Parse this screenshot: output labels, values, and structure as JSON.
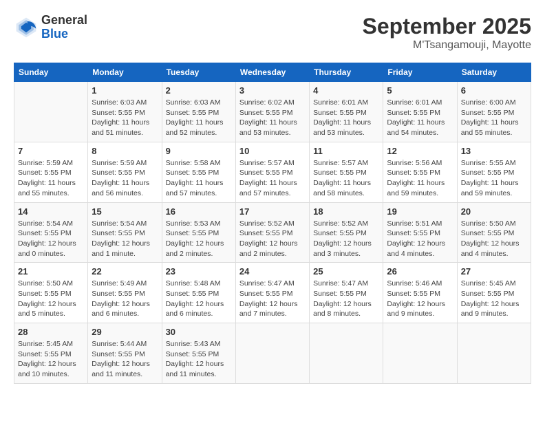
{
  "header": {
    "logo_general": "General",
    "logo_blue": "Blue",
    "month": "September 2025",
    "location": "M'Tsangamouji, Mayotte"
  },
  "days_of_week": [
    "Sunday",
    "Monday",
    "Tuesday",
    "Wednesday",
    "Thursday",
    "Friday",
    "Saturday"
  ],
  "weeks": [
    [
      {
        "day": "",
        "info": ""
      },
      {
        "day": "1",
        "info": "Sunrise: 6:03 AM\nSunset: 5:55 PM\nDaylight: 11 hours\nand 51 minutes."
      },
      {
        "day": "2",
        "info": "Sunrise: 6:03 AM\nSunset: 5:55 PM\nDaylight: 11 hours\nand 52 minutes."
      },
      {
        "day": "3",
        "info": "Sunrise: 6:02 AM\nSunset: 5:55 PM\nDaylight: 11 hours\nand 53 minutes."
      },
      {
        "day": "4",
        "info": "Sunrise: 6:01 AM\nSunset: 5:55 PM\nDaylight: 11 hours\nand 53 minutes."
      },
      {
        "day": "5",
        "info": "Sunrise: 6:01 AM\nSunset: 5:55 PM\nDaylight: 11 hours\nand 54 minutes."
      },
      {
        "day": "6",
        "info": "Sunrise: 6:00 AM\nSunset: 5:55 PM\nDaylight: 11 hours\nand 55 minutes."
      }
    ],
    [
      {
        "day": "7",
        "info": "Sunrise: 5:59 AM\nSunset: 5:55 PM\nDaylight: 11 hours\nand 55 minutes."
      },
      {
        "day": "8",
        "info": "Sunrise: 5:59 AM\nSunset: 5:55 PM\nDaylight: 11 hours\nand 56 minutes."
      },
      {
        "day": "9",
        "info": "Sunrise: 5:58 AM\nSunset: 5:55 PM\nDaylight: 11 hours\nand 57 minutes."
      },
      {
        "day": "10",
        "info": "Sunrise: 5:57 AM\nSunset: 5:55 PM\nDaylight: 11 hours\nand 57 minutes."
      },
      {
        "day": "11",
        "info": "Sunrise: 5:57 AM\nSunset: 5:55 PM\nDaylight: 11 hours\nand 58 minutes."
      },
      {
        "day": "12",
        "info": "Sunrise: 5:56 AM\nSunset: 5:55 PM\nDaylight: 11 hours\nand 59 minutes."
      },
      {
        "day": "13",
        "info": "Sunrise: 5:55 AM\nSunset: 5:55 PM\nDaylight: 11 hours\nand 59 minutes."
      }
    ],
    [
      {
        "day": "14",
        "info": "Sunrise: 5:54 AM\nSunset: 5:55 PM\nDaylight: 12 hours\nand 0 minutes."
      },
      {
        "day": "15",
        "info": "Sunrise: 5:54 AM\nSunset: 5:55 PM\nDaylight: 12 hours\nand 1 minute."
      },
      {
        "day": "16",
        "info": "Sunrise: 5:53 AM\nSunset: 5:55 PM\nDaylight: 12 hours\nand 2 minutes."
      },
      {
        "day": "17",
        "info": "Sunrise: 5:52 AM\nSunset: 5:55 PM\nDaylight: 12 hours\nand 2 minutes."
      },
      {
        "day": "18",
        "info": "Sunrise: 5:52 AM\nSunset: 5:55 PM\nDaylight: 12 hours\nand 3 minutes."
      },
      {
        "day": "19",
        "info": "Sunrise: 5:51 AM\nSunset: 5:55 PM\nDaylight: 12 hours\nand 4 minutes."
      },
      {
        "day": "20",
        "info": "Sunrise: 5:50 AM\nSunset: 5:55 PM\nDaylight: 12 hours\nand 4 minutes."
      }
    ],
    [
      {
        "day": "21",
        "info": "Sunrise: 5:50 AM\nSunset: 5:55 PM\nDaylight: 12 hours\nand 5 minutes."
      },
      {
        "day": "22",
        "info": "Sunrise: 5:49 AM\nSunset: 5:55 PM\nDaylight: 12 hours\nand 6 minutes."
      },
      {
        "day": "23",
        "info": "Sunrise: 5:48 AM\nSunset: 5:55 PM\nDaylight: 12 hours\nand 6 minutes."
      },
      {
        "day": "24",
        "info": "Sunrise: 5:47 AM\nSunset: 5:55 PM\nDaylight: 12 hours\nand 7 minutes."
      },
      {
        "day": "25",
        "info": "Sunrise: 5:47 AM\nSunset: 5:55 PM\nDaylight: 12 hours\nand 8 minutes."
      },
      {
        "day": "26",
        "info": "Sunrise: 5:46 AM\nSunset: 5:55 PM\nDaylight: 12 hours\nand 9 minutes."
      },
      {
        "day": "27",
        "info": "Sunrise: 5:45 AM\nSunset: 5:55 PM\nDaylight: 12 hours\nand 9 minutes."
      }
    ],
    [
      {
        "day": "28",
        "info": "Sunrise: 5:45 AM\nSunset: 5:55 PM\nDaylight: 12 hours\nand 10 minutes."
      },
      {
        "day": "29",
        "info": "Sunrise: 5:44 AM\nSunset: 5:55 PM\nDaylight: 12 hours\nand 11 minutes."
      },
      {
        "day": "30",
        "info": "Sunrise: 5:43 AM\nSunset: 5:55 PM\nDaylight: 12 hours\nand 11 minutes."
      },
      {
        "day": "",
        "info": ""
      },
      {
        "day": "",
        "info": ""
      },
      {
        "day": "",
        "info": ""
      },
      {
        "day": "",
        "info": ""
      }
    ]
  ]
}
